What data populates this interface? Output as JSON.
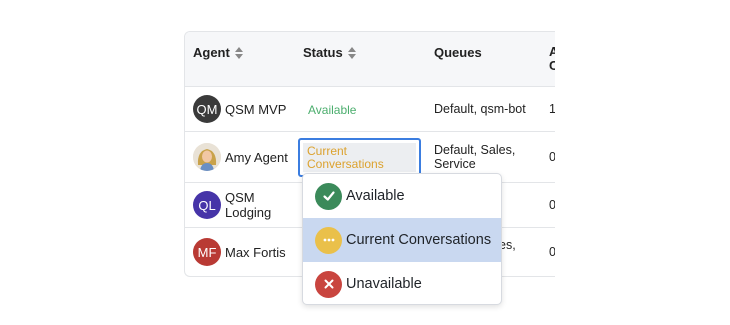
{
  "table": {
    "headers": {
      "agent": "Agent",
      "status": "Status",
      "queues": "Queues",
      "extra_line1": "A",
      "extra_line2": "C"
    },
    "rows": [
      {
        "initials": "QM",
        "name": "QSM MVP",
        "status": "Available",
        "queues": "Default, qsm-bot",
        "count": "1"
      },
      {
        "initials": "",
        "name": "Amy Agent",
        "status": "Current Conversations",
        "queues_line1": "Default, Sales,",
        "queues_line2": "Service",
        "count": "0"
      },
      {
        "initials": "QL",
        "name_line1": "QSM",
        "name_line2": "Lodging",
        "count": "0"
      },
      {
        "initials": "MF",
        "name": "Max Fortis",
        "queues_partial": "es,",
        "count": "0"
      }
    ]
  },
  "status_select": {
    "value_line1": "Current",
    "value_line2": "Conversations"
  },
  "dropdown": {
    "options": [
      {
        "label": "Available",
        "icon": "check-icon",
        "color": "#3b8a5a"
      },
      {
        "label": "Current Conversations",
        "icon": "ellipsis-icon",
        "color": "#eac04a",
        "selected": true
      },
      {
        "label": "Unavailable",
        "icon": "close-icon",
        "color": "#c9453f"
      }
    ]
  },
  "colors": {
    "available_text": "#4cae6e",
    "current_text": "#dca22e",
    "focus_border": "#3b7de0",
    "selected_option_bg": "#c9d8f0",
    "avatar_qm": "#3a3a3a",
    "avatar_ql": "#4634a8",
    "avatar_mf": "#b93a34"
  }
}
